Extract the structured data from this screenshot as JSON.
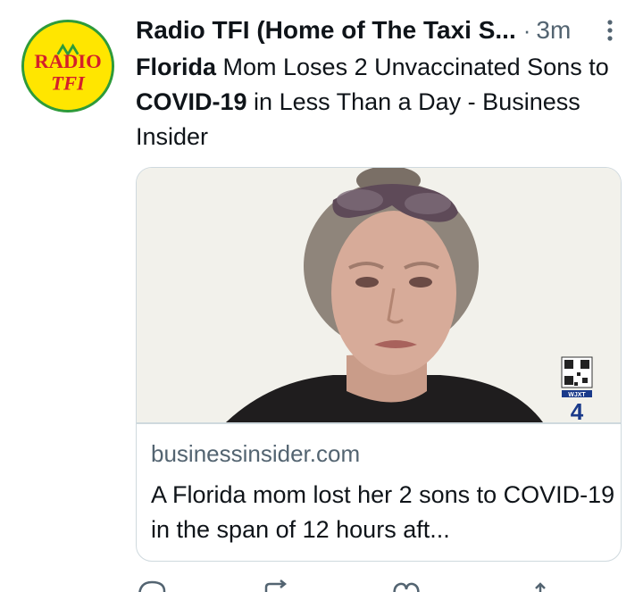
{
  "avatar": {
    "logo_top": "RADIO",
    "logo_bottom": "TFI"
  },
  "header": {
    "author": "Radio TFI (Home of The Taxi S...",
    "separator": "·",
    "time": "3m"
  },
  "tweet": {
    "bold1": "Florida",
    "text1": " Mom Loses 2 Unvaccinated Sons to ",
    "bold2": "COVID-19",
    "text2": " in Less Than a Day - Business Insider"
  },
  "card": {
    "image_badge": "WJXT",
    "image_channel": "4",
    "domain": "businessinsider.com",
    "title": "A Florida mom lost her 2 sons to COVID-19 in the span of 12 hours aft..."
  },
  "colors": {
    "secondary_text": "#536471",
    "border": "#cfd9de",
    "logo_yellow": "#ffe600",
    "logo_red": "#d4202a",
    "logo_green": "#2e9b3a"
  },
  "icons": [
    "more-icon",
    "reply-icon",
    "retweet-icon",
    "like-icon",
    "share-icon"
  ]
}
